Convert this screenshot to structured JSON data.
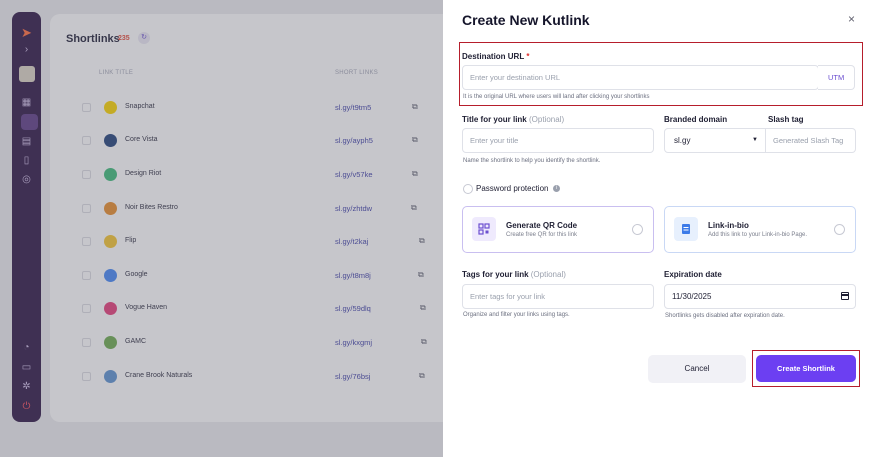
{
  "background": {
    "page_title": "Shortlinks",
    "count": "235",
    "columns": [
      "LINK TITLE",
      "SHORT LINKS"
    ],
    "rows": [
      {
        "title": "Snapchat",
        "short": "sl.gy/t9tm5",
        "icon": "snapchat-icon",
        "color": "#f7d100"
      },
      {
        "title": "Core Vista",
        "short": "sl.gy/ayph5",
        "icon": "core-vista-icon",
        "color": "#1f3f7a"
      },
      {
        "title": "Design Riot",
        "short": "sl.gy/v57ke",
        "icon": "design-riot-icon",
        "color": "#3bb87a"
      },
      {
        "title": "Noir Bites Restro",
        "short": "sl.gy/zhtdw",
        "icon": "noir-bites-icon",
        "color": "#e58a2b"
      },
      {
        "title": "Flip",
        "short": "sl.gy/t2kaj",
        "icon": "flip-icon",
        "color": "#f2c230"
      },
      {
        "title": "Google",
        "short": "sl.gy/t8m8j",
        "icon": "google-icon",
        "color": "#4285f4"
      },
      {
        "title": "Vogue Haven",
        "short": "sl.gy/59dlq",
        "icon": "vogue-haven-icon",
        "color": "#e23b7a"
      },
      {
        "title": "GAMC",
        "short": "sl.gy/kxgmj",
        "icon": "gamc-icon",
        "color": "#6aa84f"
      },
      {
        "title": "Crane Brook Naturals",
        "short": "sl.gy/76bsj",
        "icon": "crane-brook-icon",
        "color": "#5a8fd0"
      }
    ]
  },
  "drawer": {
    "title": "Create New Kutlink",
    "close": "×",
    "destination": {
      "label": "Destination URL",
      "required_mark": "*",
      "placeholder": "Enter your destination URL",
      "utm": "UTM",
      "hint": "It is the original URL where users will land after clicking your shortlinks"
    },
    "title_field": {
      "label": "Title for your link",
      "optional": "(Optional)",
      "placeholder": "Enter your title",
      "hint": "Name the shortlink to help you identify the shortlink."
    },
    "branded_domain": {
      "label": "Branded domain",
      "value": "sl.gy"
    },
    "slash_tag": {
      "label": "Slash tag",
      "placeholder": "Generated Slash Tag"
    },
    "password": {
      "label": "Password protection"
    },
    "qr_card": {
      "title": "Generate QR Code",
      "subtitle": "Create free QR for this link"
    },
    "bio_card": {
      "title": "Link-in-bio",
      "subtitle": "Add this link to your Link-in-bio Page."
    },
    "tags": {
      "label": "Tags for your link",
      "optional": "(Optional)",
      "placeholder": "Enter tags for your link",
      "hint": "Organize and filter your links using tags."
    },
    "expiration": {
      "label": "Expiration date",
      "value": "11/30/2025",
      "hint": "Shortlinks gets disabled after expiration  date."
    },
    "cancel_label": "Cancel",
    "create_label": "Create Shortlink"
  },
  "colors": {
    "accent": "#6c3ff2",
    "highlight_box": "#b61e2c",
    "sidebar": "#2c1546"
  }
}
